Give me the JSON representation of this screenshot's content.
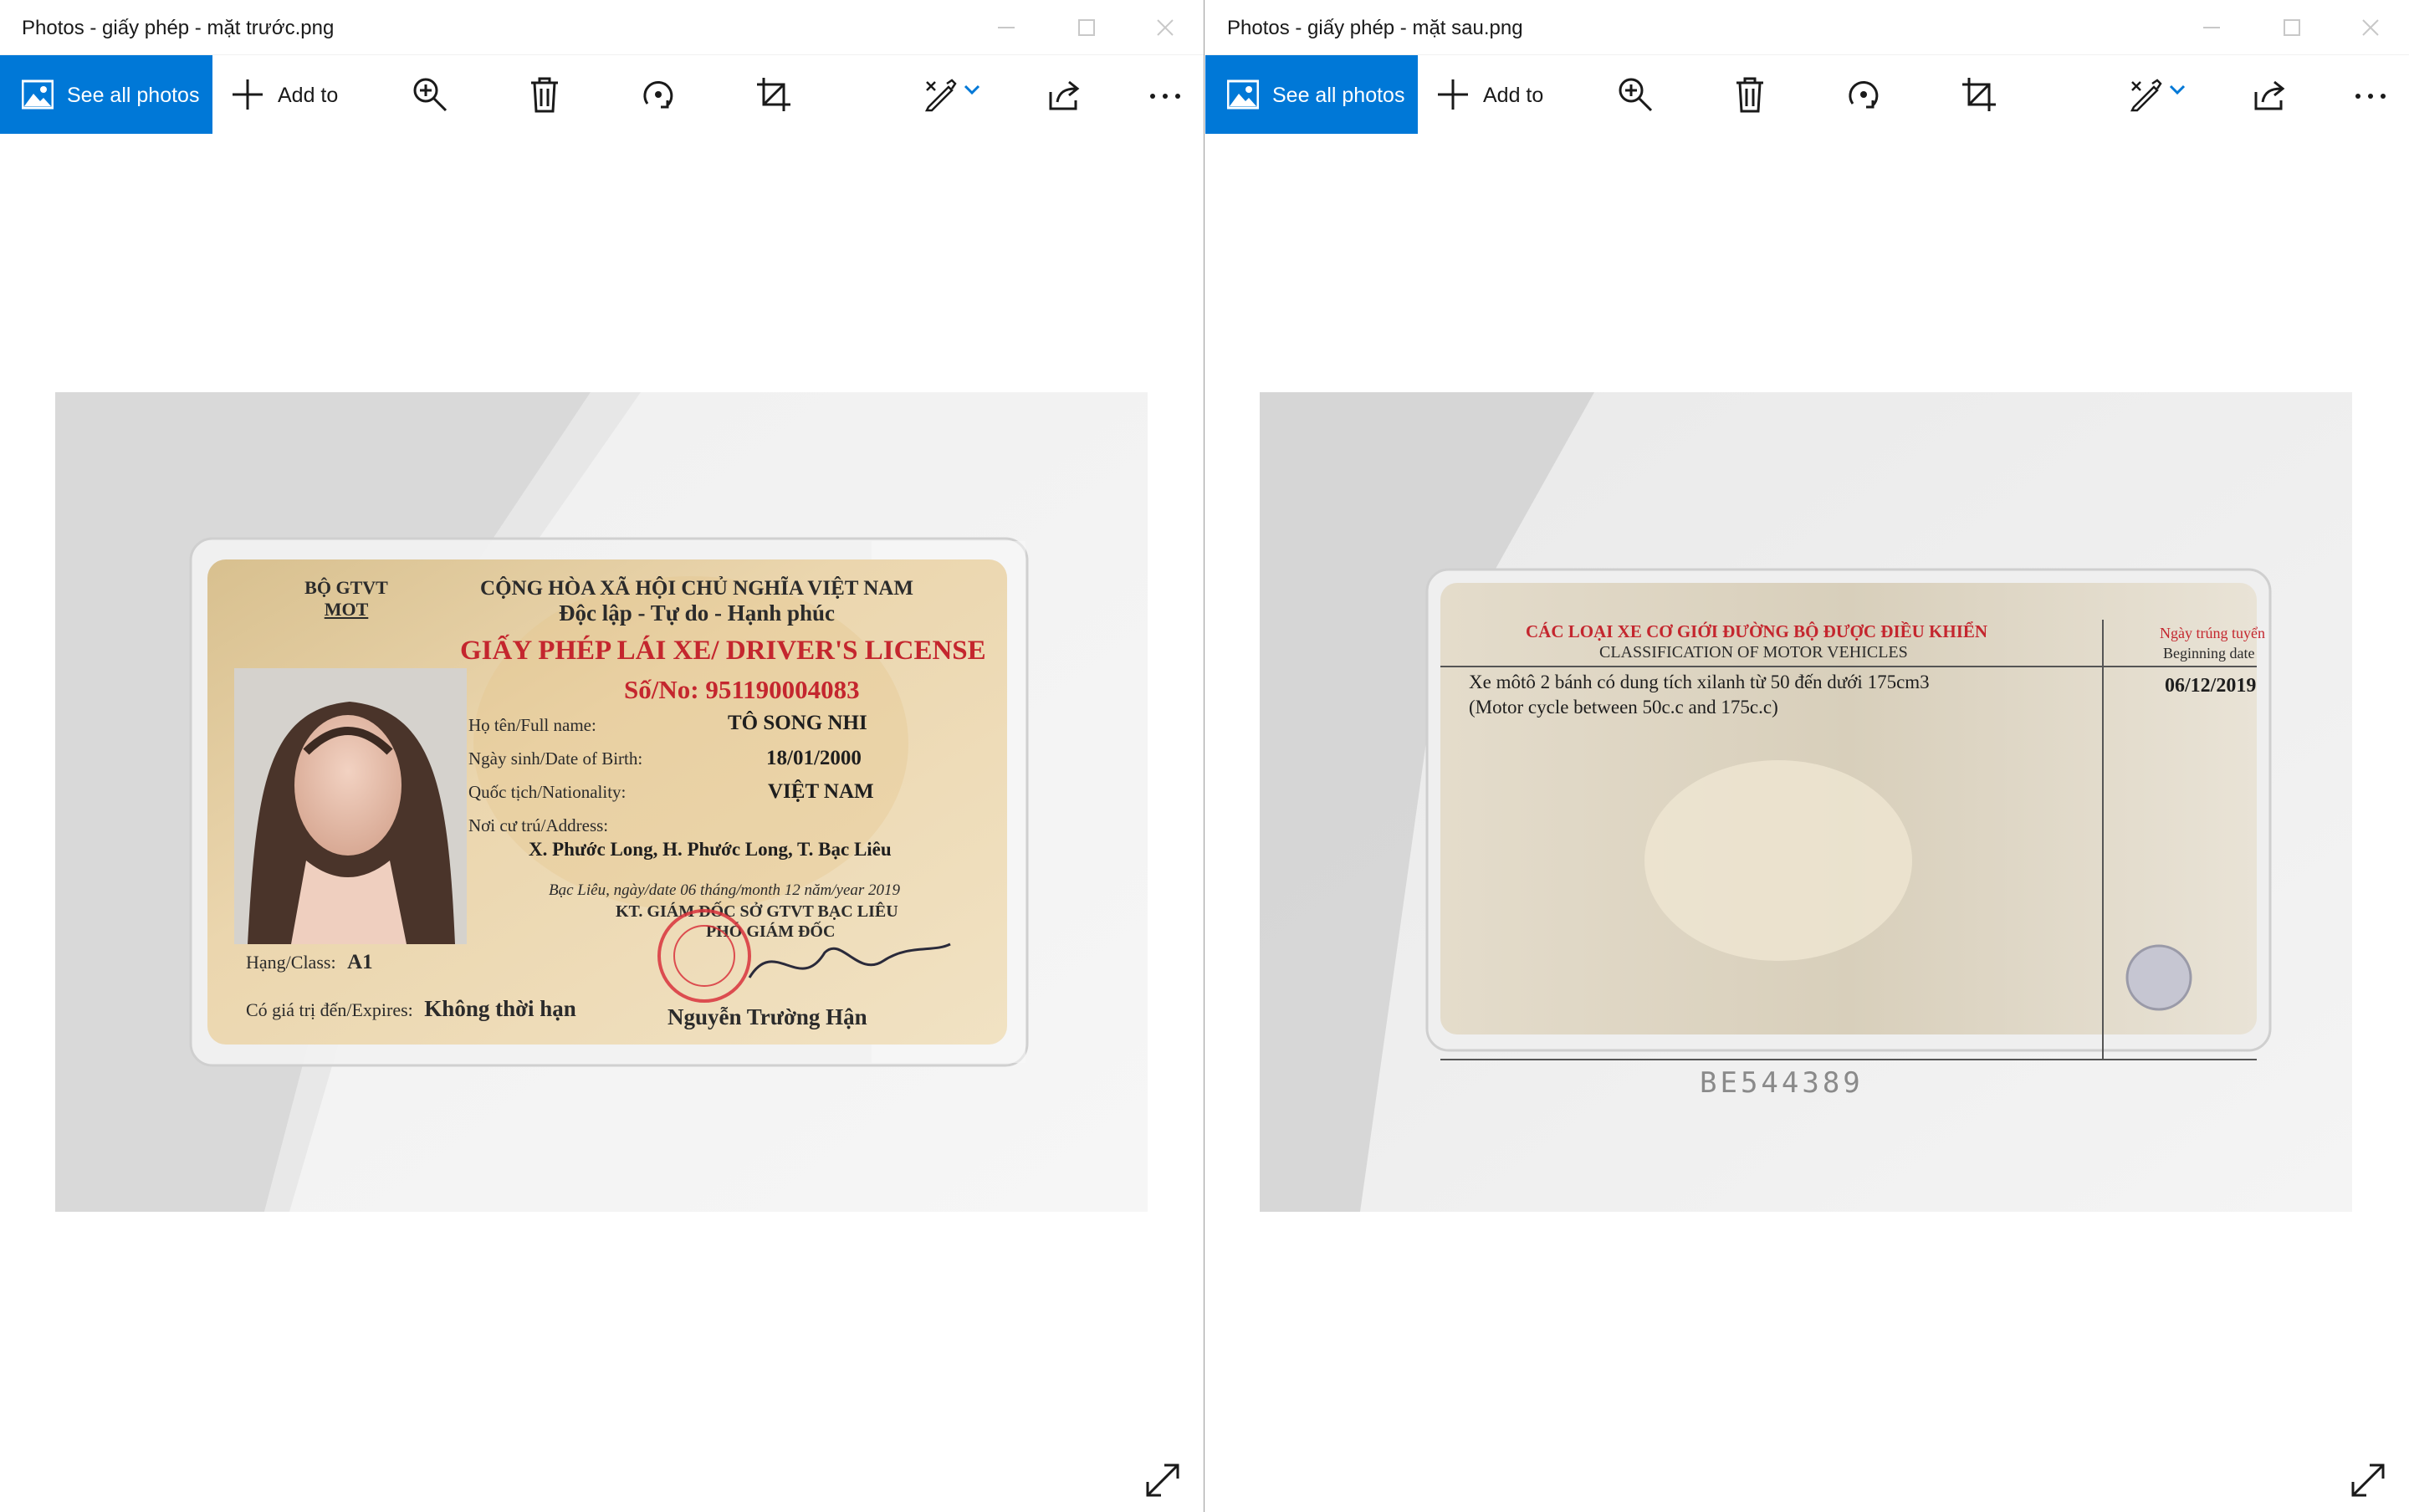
{
  "windows": [
    {
      "id": "left",
      "title": "Photos - giấy phép - mặt trước.png",
      "toolbar": {
        "see_all_label": "See all photos",
        "add_to_label": "Add to",
        "icons": [
          "picture-icon",
          "plus-icon",
          "zoom-in-icon",
          "delete-icon",
          "rotate-icon",
          "crop-icon",
          "edit-create-icon",
          "chevron-down-icon",
          "share-icon",
          "more-icon"
        ]
      },
      "photo": {
        "header_left": [
          "BỘ GTVT",
          "MOT"
        ],
        "header_right": [
          "CỘNG HÒA XÃ HỘI CHỦ NGHĨA VIỆT NAM",
          "Độc lập  - Tự do - Hạnh phúc"
        ],
        "card_title": "GIẤY PHÉP LÁI XE/ DRIVER'S LICENSE",
        "number_label": "Số/No:",
        "number": "951190004083",
        "name_label": "Họ tên/Full name:",
        "name": "TÔ SONG NHI",
        "dob_label": "Ngày sinh/Date of Birth:",
        "dob": "18/01/2000",
        "nationality_label": "Quốc tịch/Nationality:",
        "nationality": "VIỆT NAM",
        "address_label": "Nơi cư trú/Address:",
        "address": "X. Phước Long, H. Phước Long, T. Bạc Liêu",
        "issue_line": "Bạc Liêu, ngày/date 06 tháng/month 12 năm/year 2019",
        "authority_1": "KT. GIÁM ĐỐC SỞ GTVT BẠC LIÊU",
        "authority_2": "PHÓ GIÁM ĐỐC",
        "class_label": "Hạng/Class:",
        "class": "A1",
        "expires_label": "Có giá trị đến/Expires:",
        "expires": "Không thời hạn",
        "signer": "Nguyễn Trường Hận"
      }
    },
    {
      "id": "right",
      "title": "Photos - giấy phép - mặt sau.png",
      "toolbar": {
        "see_all_label": "See all photos",
        "add_to_label": "Add to",
        "icons": [
          "picture-icon",
          "plus-icon",
          "zoom-in-icon",
          "delete-icon",
          "rotate-icon",
          "crop-icon",
          "edit-create-icon",
          "chevron-down-icon",
          "share-icon",
          "more-icon"
        ]
      },
      "photo": {
        "heading_vn": "CÁC LOẠI XE CƠ GIỚI ĐƯỜNG BỘ ĐƯỢC ĐIỀU KHIỂN",
        "heading_en": "CLASSIFICATION OF MOTOR VEHICLES",
        "date_heading_vn": "Ngày trúng tuyển",
        "date_heading_en": "Beginning date",
        "vehicle_vn": "Xe môtô 2 bánh có dung tích xilanh từ 50 đến dưới 175cm3",
        "vehicle_en": "(Motor cycle between 50c.c and  175c.c)",
        "beginning_date": "06/12/2019",
        "serial": "BE544389"
      }
    }
  ],
  "colors": {
    "accent": "#0078d7",
    "license_red": "#c4262e",
    "card_bg": "#e4cda0",
    "backdrop": "#dcdcdc"
  }
}
